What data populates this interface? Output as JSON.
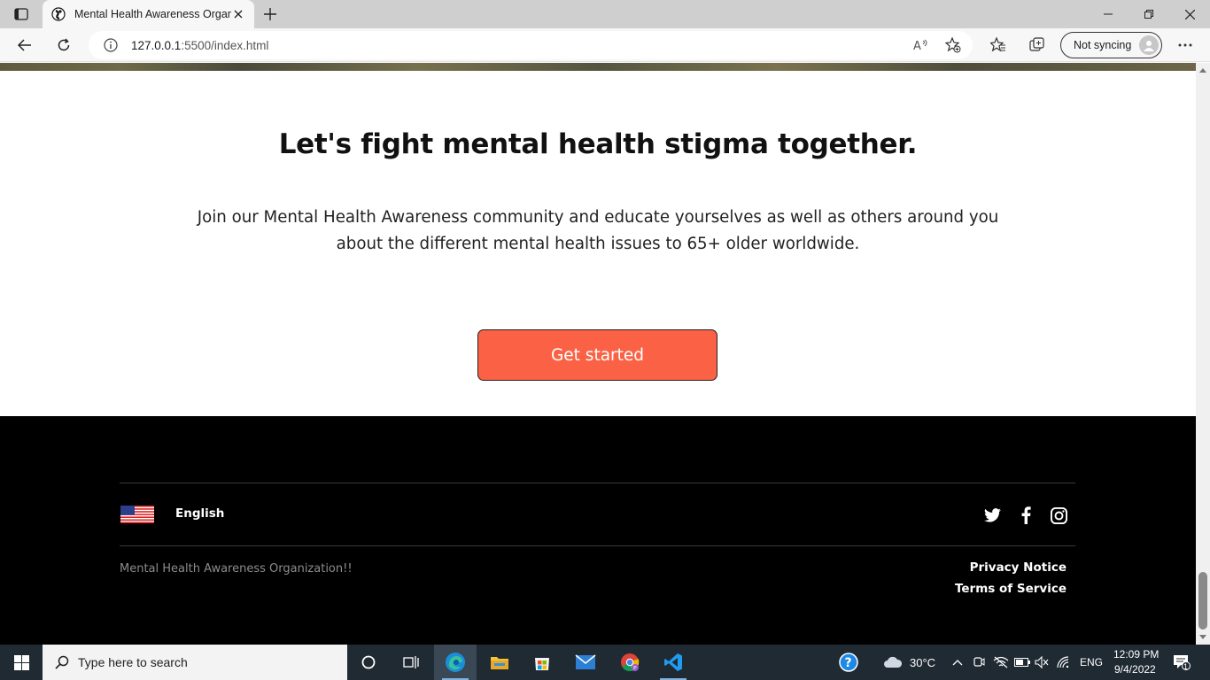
{
  "browser": {
    "tab_title": "Mental Health Awareness Organ",
    "url_host": "127.0.0.1",
    "url_path": ":5500/index.html",
    "sync_label": "Not syncing"
  },
  "cta": {
    "title": "Let's fight mental health stigma together.",
    "text": "Join our Mental Health Awareness community and educate yourselves as well as others around you about the different mental health issues to 65+ older worldwide.",
    "button_label": "Get started",
    "button_color": "#fb6245"
  },
  "footer": {
    "language": "English",
    "org_name": "Mental Health Awareness Organization!!",
    "privacy": "Privacy Notice",
    "terms": "Terms of Service",
    "social_icons": [
      "twitter-icon",
      "facebook-icon",
      "instagram-icon"
    ]
  },
  "taskbar": {
    "search_placeholder": "Type here to search",
    "temperature": "30°C",
    "language": "ENG",
    "time": "12:09 PM",
    "date": "9/4/2022",
    "notification_count": "1"
  }
}
